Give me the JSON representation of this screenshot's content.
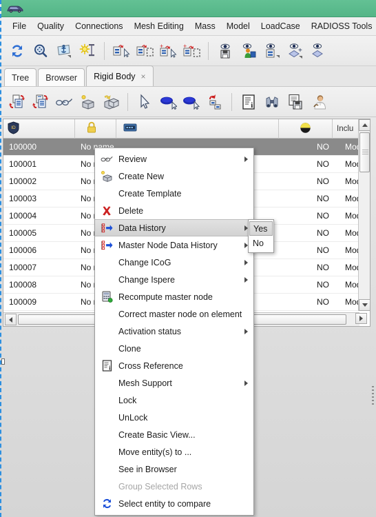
{
  "window": {
    "title": "",
    "app_icon": "car-icon",
    "titlebar_color": "#5cbb8e"
  },
  "menubar": {
    "items": [
      {
        "label": "File",
        "name": "menu-file"
      },
      {
        "label": "Quality",
        "name": "menu-quality"
      },
      {
        "label": "Connections",
        "name": "menu-connections"
      },
      {
        "label": "Mesh Editing",
        "name": "menu-mesh-editing"
      },
      {
        "label": "Mass",
        "name": "menu-mass"
      },
      {
        "label": "Model",
        "name": "menu-model"
      },
      {
        "label": "LoadCase",
        "name": "menu-loadcase"
      },
      {
        "label": "RADIOSS Tools",
        "name": "menu-radioss-tools"
      }
    ]
  },
  "toolbar_top": {
    "buttons": [
      {
        "name": "refresh-icon",
        "tip": "Refresh"
      },
      {
        "name": "zoom-fit-icon",
        "tip": "Fit view"
      },
      {
        "name": "anchor-plane-icon",
        "tip": "Plane anchor"
      },
      {
        "name": "light-source-icon",
        "tip": "Light"
      },
      {
        "name": "import-selected-icon",
        "tip": "Import selected"
      },
      {
        "name": "import-box-icon",
        "tip": "Import box"
      },
      {
        "name": "add-import-selected-icon",
        "tip": "Add import selected"
      },
      {
        "name": "add-import-box-icon",
        "tip": "Add import box"
      },
      {
        "name": "eye-save-icon",
        "tip": "Save view"
      },
      {
        "name": "eye-users-icon",
        "tip": "View users"
      },
      {
        "name": "eye-list-icon",
        "tip": "View list"
      },
      {
        "name": "eye-add-shape-icon",
        "tip": "Add shape view"
      },
      {
        "name": "eye-shape-icon",
        "tip": "Shape view"
      }
    ]
  },
  "toolbar_second": {
    "buttons": [
      {
        "name": "copy-left-icon",
        "tip": "Copy from"
      },
      {
        "name": "copy-right-icon",
        "tip": "Copy to"
      },
      {
        "name": "glasses-review-icon",
        "tip": "Review"
      },
      {
        "name": "create-new-box-icon",
        "tip": "Create new"
      },
      {
        "name": "create-multi-box-icon",
        "tip": "Create multiple"
      },
      {
        "name": "cursor-select-icon",
        "tip": "Select"
      },
      {
        "name": "blue-shape-icon",
        "tip": "Entity"
      },
      {
        "name": "blue-shape-cursor-icon",
        "tip": "Pick entity"
      },
      {
        "name": "undo-tree-icon",
        "tip": "Undo"
      },
      {
        "name": "card-info-icon",
        "tip": "Card info"
      },
      {
        "name": "binoculars-find-icon",
        "tip": "Find"
      },
      {
        "name": "save-page-icon",
        "tip": "Save page"
      },
      {
        "name": "user-profile-icon",
        "tip": "User"
      }
    ]
  },
  "tabs": {
    "items": [
      {
        "label": "Tree",
        "name": "tab-tree",
        "active": false,
        "closable": false
      },
      {
        "label": "Browser",
        "name": "tab-browser",
        "active": false,
        "closable": false
      },
      {
        "label": "Rigid Body",
        "name": "tab-rigid-body",
        "active": true,
        "closable": true,
        "close_glyph": "×"
      }
    ]
  },
  "table": {
    "columns": [
      {
        "label": "",
        "icon": "id-badge-icon",
        "name": "column-id"
      },
      {
        "label": "",
        "icon": "lock-icon",
        "name": "column-lock"
      },
      {
        "label": "",
        "icon": "card-icon",
        "name": "column-name"
      },
      {
        "label": "",
        "icon": "pie-flag-icon",
        "name": "column-flag"
      },
      {
        "label": "Inclu",
        "icon": "",
        "name": "column-include"
      }
    ],
    "rows": [
      {
        "id": "100000",
        "name": "No name",
        "flag": "NO",
        "include": "Mod",
        "selected": true
      },
      {
        "id": "100001",
        "name": "No name",
        "flag": "NO",
        "include": "Mod",
        "selected": false
      },
      {
        "id": "100002",
        "name": "No name",
        "flag": "NO",
        "include": "Mod",
        "selected": false
      },
      {
        "id": "100003",
        "name": "No name",
        "flag": "NO",
        "include": "Mod",
        "selected": false
      },
      {
        "id": "100004",
        "name": "No name",
        "flag": "NO",
        "include": "Mod",
        "selected": false
      },
      {
        "id": "100005",
        "name": "No name",
        "flag": "NO",
        "include": "Mod",
        "selected": false
      },
      {
        "id": "100006",
        "name": "No name",
        "flag": "NO",
        "include": "Mod",
        "selected": false
      },
      {
        "id": "100007",
        "name": "No name",
        "flag": "NO",
        "include": "Mod",
        "selected": false
      },
      {
        "id": "100008",
        "name": "No name",
        "flag": "NO",
        "include": "Mod",
        "selected": false
      },
      {
        "id": "100009",
        "name": "No name",
        "flag": "NO",
        "include": "Mod",
        "selected": false
      }
    ]
  },
  "context_menu": {
    "items": [
      {
        "label": "Review",
        "icon": "glasses-icon",
        "submenu": true,
        "highlighted": false,
        "disabled": false,
        "name": "ctx-review"
      },
      {
        "label": "Create New",
        "icon": "create-new-icon",
        "submenu": false,
        "highlighted": false,
        "disabled": false,
        "name": "ctx-create-new"
      },
      {
        "label": "Create Template",
        "icon": "",
        "submenu": false,
        "highlighted": false,
        "disabled": false,
        "name": "ctx-create-template"
      },
      {
        "label": "Delete",
        "icon": "delete-x-icon",
        "submenu": false,
        "highlighted": false,
        "disabled": false,
        "name": "ctx-delete"
      },
      {
        "label": "Data History",
        "icon": "data-history-icon",
        "submenu": true,
        "highlighted": true,
        "disabled": false,
        "name": "ctx-data-history"
      },
      {
        "label": "Master Node Data History",
        "icon": "data-history-icon",
        "submenu": true,
        "highlighted": false,
        "disabled": false,
        "name": "ctx-master-node-data-history"
      },
      {
        "label": "Change ICoG",
        "icon": "",
        "submenu": true,
        "highlighted": false,
        "disabled": false,
        "name": "ctx-change-icog"
      },
      {
        "label": "Change Ispere",
        "icon": "",
        "submenu": true,
        "highlighted": false,
        "disabled": false,
        "name": "ctx-change-ispere"
      },
      {
        "label": "Recompute master node",
        "icon": "recompute-icon",
        "submenu": false,
        "highlighted": false,
        "disabled": false,
        "name": "ctx-recompute-master-node"
      },
      {
        "label": "Correct master node on element",
        "icon": "",
        "submenu": false,
        "highlighted": false,
        "disabled": false,
        "name": "ctx-correct-master-node-on-element"
      },
      {
        "label": "Activation status",
        "icon": "",
        "submenu": true,
        "highlighted": false,
        "disabled": false,
        "name": "ctx-activation-status"
      },
      {
        "label": "Clone",
        "icon": "",
        "submenu": false,
        "highlighted": false,
        "disabled": false,
        "name": "ctx-clone"
      },
      {
        "label": "Cross Reference",
        "icon": "cross-reference-icon",
        "submenu": false,
        "highlighted": false,
        "disabled": false,
        "name": "ctx-cross-reference"
      },
      {
        "label": "Mesh Support",
        "icon": "",
        "submenu": true,
        "highlighted": false,
        "disabled": false,
        "name": "ctx-mesh-support"
      },
      {
        "label": "Lock",
        "icon": "",
        "submenu": false,
        "highlighted": false,
        "disabled": false,
        "name": "ctx-lock"
      },
      {
        "label": "UnLock",
        "icon": "",
        "submenu": false,
        "highlighted": false,
        "disabled": false,
        "name": "ctx-unlock"
      },
      {
        "label": "Create Basic View...",
        "icon": "",
        "submenu": false,
        "highlighted": false,
        "disabled": false,
        "name": "ctx-create-basic-view"
      },
      {
        "label": "Move entity(s) to ...",
        "icon": "",
        "submenu": false,
        "highlighted": false,
        "disabled": false,
        "name": "ctx-move-entity-to"
      },
      {
        "label": "See in Browser",
        "icon": "",
        "submenu": false,
        "highlighted": false,
        "disabled": false,
        "name": "ctx-see-in-browser"
      },
      {
        "label": "Group Selected Rows",
        "icon": "",
        "submenu": false,
        "highlighted": false,
        "disabled": true,
        "name": "ctx-group-selected-rows"
      },
      {
        "label": "Select entity to compare",
        "icon": "refresh-blue-icon",
        "submenu": false,
        "highlighted": false,
        "disabled": false,
        "name": "ctx-select-entity-to-compare"
      }
    ]
  },
  "submenu": {
    "parent": "Data History",
    "items": [
      {
        "label": "Yes",
        "highlighted": true,
        "name": "submenu-yes"
      },
      {
        "label": "No",
        "highlighted": false,
        "name": "submenu-no"
      }
    ]
  },
  "colors": {
    "titlebar": "#5cbb8e",
    "selection": "#8a8a8a",
    "menu_highlight": "#d8d8d8",
    "accent_blue": "#2255cc",
    "delete_red": "#cc2222",
    "lock_yellow": "#e8c84a"
  }
}
